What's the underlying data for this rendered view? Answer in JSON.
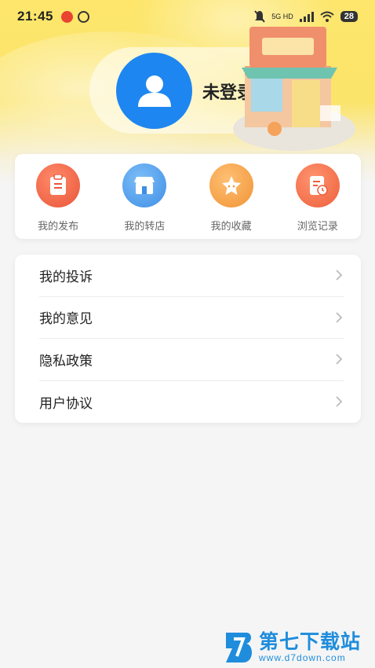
{
  "status_bar": {
    "time": "21:45",
    "network": "5G HD",
    "battery": "28",
    "icons": [
      "weibo-icon",
      "notification-icon",
      "mute-icon",
      "signal-icon",
      "wifi-icon",
      "battery-icon"
    ]
  },
  "profile": {
    "login_text": "未登录",
    "avatar_icon": "user-avatar-icon",
    "accent_color": "#1e86f0"
  },
  "quick_actions": [
    {
      "label": "我的发布",
      "icon": "clipboard-icon",
      "color": "#f26b4e"
    },
    {
      "label": "我的转店",
      "icon": "shop-icon",
      "color": "#5aa8f2"
    },
    {
      "label": "我的收藏",
      "icon": "star-icon",
      "color": "#f6a24c"
    },
    {
      "label": "浏览记录",
      "icon": "history-icon",
      "color": "#f4744c"
    }
  ],
  "menu": [
    {
      "label": "我的投诉"
    },
    {
      "label": "我的意见"
    },
    {
      "label": "隐私政策"
    },
    {
      "label": "用户协议"
    }
  ],
  "watermark": {
    "title": "第七下载站",
    "url": "www.d7down.com"
  }
}
